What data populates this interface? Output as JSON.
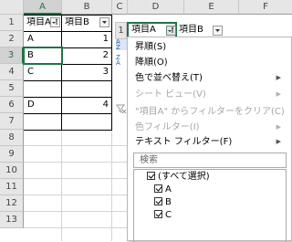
{
  "sheet1": {
    "columns": [
      "A",
      "B",
      "C"
    ],
    "rows": [
      "1",
      "2",
      "3",
      "4",
      "5",
      "6",
      "7",
      "8",
      "9",
      "10",
      "11",
      "12",
      "13"
    ],
    "header": {
      "a": "項目A",
      "b": "項目B"
    },
    "data": [
      {
        "a": "A",
        "b": "1"
      },
      {
        "a": "B",
        "b": "2"
      },
      {
        "a": "C",
        "b": "3"
      },
      {
        "a": "",
        "b": ""
      },
      {
        "a": "D",
        "b": "4"
      }
    ]
  },
  "sheet2": {
    "columns": [
      "D",
      "E",
      "F"
    ],
    "row_label": "1",
    "header": {
      "a": "項目A",
      "b": "項目B"
    }
  },
  "menu": {
    "items": [
      {
        "label": "昇順(S)",
        "enabled": true
      },
      {
        "label": "降順(O)",
        "enabled": true
      },
      {
        "label": "色で並べ替え(T)",
        "enabled": true
      },
      {
        "label": "シート ビュー(V)",
        "enabled": false
      },
      {
        "label": "\"項目A\" からフィルターをクリア(C)",
        "enabled": false
      },
      {
        "label": "色フィルター(I)",
        "enabled": false
      },
      {
        "label": "テキスト フィルター(F)",
        "enabled": true
      }
    ],
    "search_placeholder": "検索",
    "checklist": [
      {
        "label": "(すべて選択)",
        "checked": true
      },
      {
        "label": "A",
        "checked": true
      },
      {
        "label": "B",
        "checked": true
      },
      {
        "label": "C",
        "checked": true
      }
    ]
  },
  "colors": {
    "accent": "#217346",
    "grid": "#d4d4d4",
    "header_bg": "#e6e6e6"
  }
}
